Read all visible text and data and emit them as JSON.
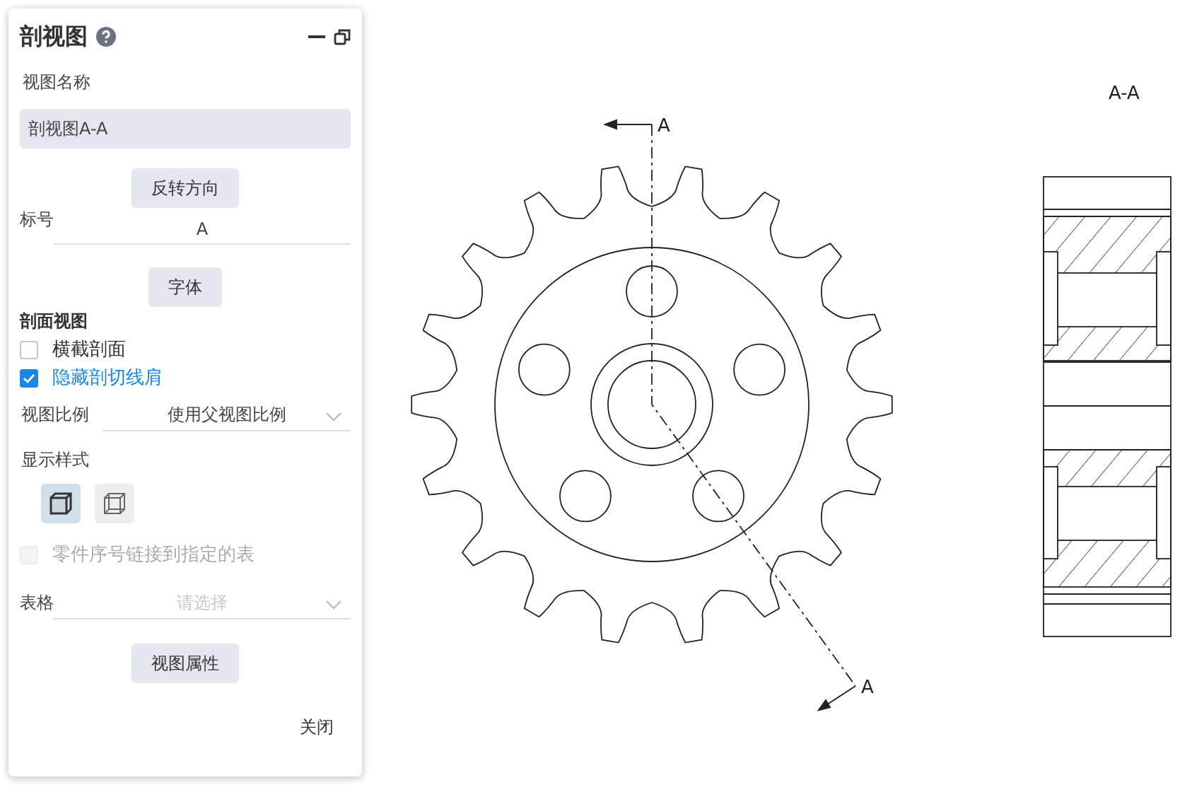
{
  "panel": {
    "title": "剖视图",
    "view_name": {
      "label": "视图名称",
      "value": "剖视图A-A"
    },
    "reverse_button": "反转方向",
    "label_field": {
      "label": "标号",
      "value": "A"
    },
    "font_button": "字体",
    "section_heading": "剖面视图",
    "checkboxes": [
      {
        "label": "横截剖面",
        "checked": false,
        "disabled": false
      },
      {
        "label": "隐藏剖切线肩",
        "checked": true,
        "disabled": false
      }
    ],
    "scale": {
      "label": "视图比例",
      "value": "使用父视图比例"
    },
    "display_style": {
      "label": "显示样式",
      "options": [
        {
          "kind": "shaded",
          "selected": true
        },
        {
          "kind": "wireframe",
          "selected": false
        }
      ]
    },
    "link_checkbox": {
      "label": "零件序号链接到指定的表",
      "checked": false,
      "disabled": true
    },
    "table": {
      "label": "表格",
      "placeholder": "请选择"
    },
    "properties_button": "视图属性",
    "close_button": "关闭"
  },
  "drawing": {
    "cut_labels": [
      "A",
      "A"
    ],
    "section_title": "A-A"
  }
}
